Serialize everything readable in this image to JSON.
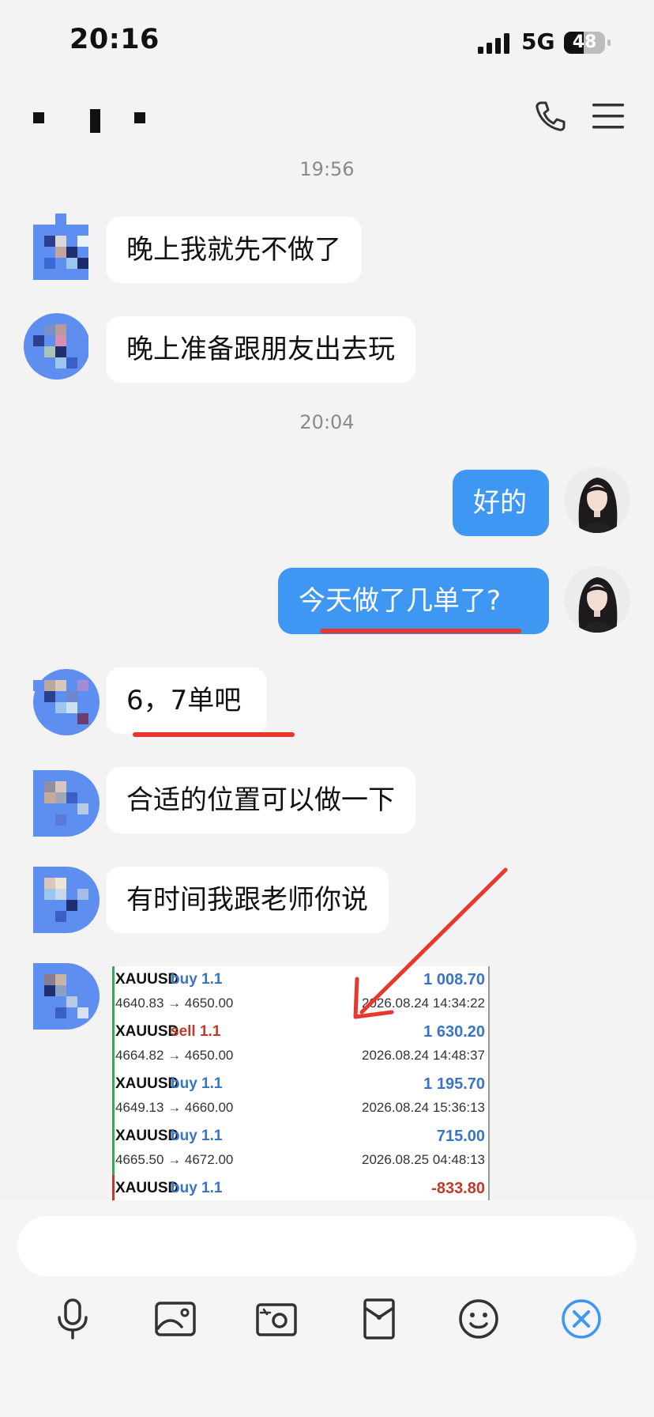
{
  "status_bar": {
    "time": "20:16",
    "network": "5G",
    "battery": "48",
    "battery_level": 0.48
  },
  "header": {
    "menu_icon": "menu-icon",
    "call_icon": "phone-icon"
  },
  "messages": [
    {
      "type": "timestamp",
      "text": "19:56"
    },
    {
      "type": "in",
      "text": "晚上我就先不做了"
    },
    {
      "type": "in",
      "text": "晚上准备跟朋友出去玩"
    },
    {
      "type": "timestamp",
      "text": "20:04"
    },
    {
      "type": "out",
      "text": "好的"
    },
    {
      "type": "out",
      "text": "今天做了几单了?"
    },
    {
      "type": "in",
      "text": "6，7单吧"
    },
    {
      "type": "in",
      "text": "合适的位置可以做一下"
    },
    {
      "type": "in",
      "text": "有时间我跟老师你说"
    }
  ],
  "trades": [
    {
      "symbol": "XAUUSD",
      "side": "buy 1.1",
      "range": "4640.83 → 4650.00",
      "profit": "1 008.70",
      "date": "2026.08.24 14:34:22",
      "profit_color": "#3a74c4",
      "side_color": "#3a74c4"
    },
    {
      "symbol": "XAUUSD",
      "side": "sell 1.1",
      "range": "4664.82 → 4650.00",
      "profit": "1 630.20",
      "date": "2026.08.24 14:48:37",
      "profit_color": "#3a74c4",
      "side_color": "#c0392b"
    },
    {
      "symbol": "XAUUSD",
      "side": "buy 1.1",
      "range": "4649.13 → 4660.00",
      "profit": "1 195.70",
      "date": "2026.08.24 15:36:13",
      "profit_color": "#3a74c4",
      "side_color": "#3a74c4"
    },
    {
      "symbol": "XAUUSD",
      "side": "buy 1.1",
      "range": "4665.50 → 4672.00",
      "profit": "715.00",
      "date": "2026.08.25 04:48:13",
      "profit_color": "#3a74c4",
      "side_color": "#3a74c4"
    },
    {
      "symbol": "XAUUSD",
      "side": "buy 1.1",
      "range": "",
      "profit": "-833.80",
      "date": "",
      "profit_color": "#c0392b",
      "side_color": "#3a74c4"
    }
  ],
  "toolbar": {
    "icons": [
      "microphone-icon",
      "image-icon",
      "camera-icon",
      "red-packet-icon",
      "emoji-icon",
      "close-icon"
    ]
  },
  "colors": {
    "accent": "#3e97f2",
    "underline": "#e8372f",
    "arrow": "#e8372f"
  }
}
